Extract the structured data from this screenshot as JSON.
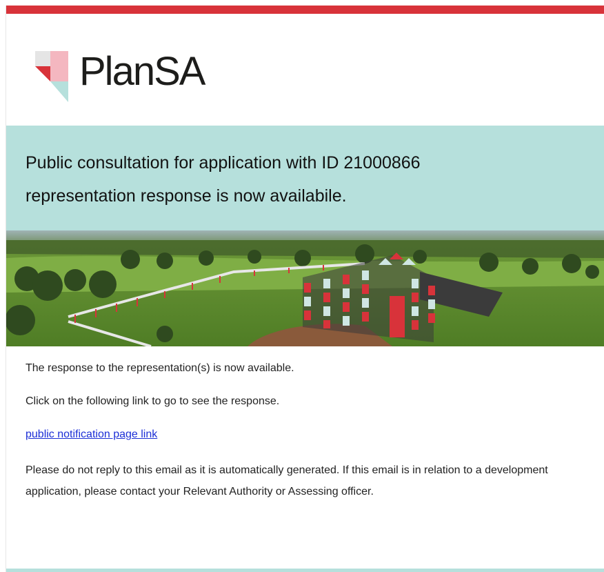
{
  "brand": {
    "name": "PlanSA",
    "colors": {
      "accent_red": "#d8333a",
      "banner_teal": "#b6e0dc",
      "link_blue": "#1c2fd6",
      "logo_pink": "#f4b7c0"
    }
  },
  "banner": {
    "line1": "Public consultation for application with ID 21000866",
    "line2": "representation response is now availabile."
  },
  "hero": {
    "icon": "farmhouse-landscape-image"
  },
  "body": {
    "line1": "The response to the representation(s) is now available.",
    "line2": "Click on the following link to go to see the response.",
    "link_text": "public notification page link",
    "disclaimer": "Please do not reply to this email as it is automatically generated. If this email is in relation to a development application, please contact your Relevant Authority or Assessing officer."
  }
}
